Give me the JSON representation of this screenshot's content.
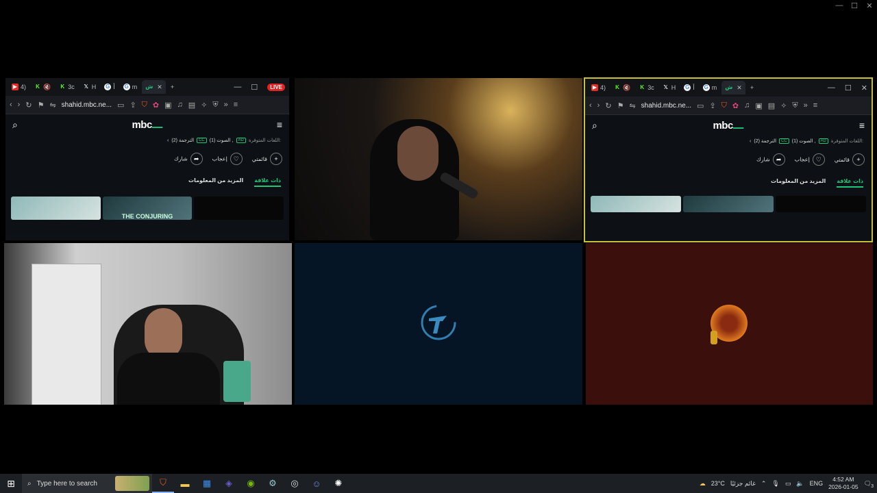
{
  "window_controls": {
    "minimize": "—",
    "maximize": "☐",
    "close": "✕"
  },
  "browser_left": {
    "tabs": [
      {
        "label": "4)",
        "favicon": "youtube-icon",
        "color": "#e52d27"
      },
      {
        "label": "",
        "favicon": "kick-icon",
        "color": "#53fc18"
      },
      {
        "label": "3c",
        "favicon": "kick-icon",
        "color": "#53fc18"
      },
      {
        "label": "H",
        "favicon": "x-icon",
        "color": "#ffffff"
      },
      {
        "label": "أ",
        "favicon": "google-icon",
        "color": "#4285f4"
      },
      {
        "label": "m",
        "favicon": "google-icon",
        "color": "#4285f4"
      },
      {
        "label": "ش",
        "favicon": "shahid-icon",
        "color": "#1dc77a"
      }
    ],
    "live_badge": "LIVE",
    "url": "shahid.mbc.ne..."
  },
  "browser_right": {
    "tabs": [
      {
        "label": "4)",
        "favicon": "youtube-icon",
        "color": "#e52d27"
      },
      {
        "label": "",
        "favicon": "kick-icon",
        "color": "#53fc18"
      },
      {
        "label": "3c",
        "favicon": "kick-icon",
        "color": "#53fc18"
      },
      {
        "label": "H",
        "favicon": "x-icon",
        "color": "#ffffff"
      },
      {
        "label": "أ",
        "favicon": "google-icon",
        "color": "#4285f4"
      },
      {
        "label": "m",
        "favicon": "google-icon",
        "color": "#4285f4"
      },
      {
        "label": "ش",
        "favicon": "shahid-icon",
        "color": "#1dc77a"
      }
    ],
    "url": "shahid.mbc.ne..."
  },
  "site": {
    "logo": "mbc",
    "logo_accent": "ـــ",
    "languages_label": "اللغات المتوفرة:",
    "audio": "الصوت (1) ,",
    "subtitles": "الترجمة (2)",
    "ad_badge": "AD",
    "cc_badge": "CC",
    "actions": {
      "list": "قائمتي",
      "like": "إعجاب",
      "share": "شارك"
    },
    "tabs": {
      "related": "ذات علاقة",
      "more_info": "المزيد من المعلومات"
    },
    "thumb_conjuring": "THE CONJURING"
  },
  "taskbar": {
    "search_placeholder": "Type here to search",
    "weather_temp": "23°C",
    "weather_text": "غائم جزئيًا",
    "language": "ENG",
    "time": "4:52 AM",
    "date": "2026-01-05",
    "notifications": "3"
  },
  "colors": {
    "accent": "#1dc77a",
    "selection_border": "#c9c138",
    "taskbar": "#1c1f24"
  }
}
